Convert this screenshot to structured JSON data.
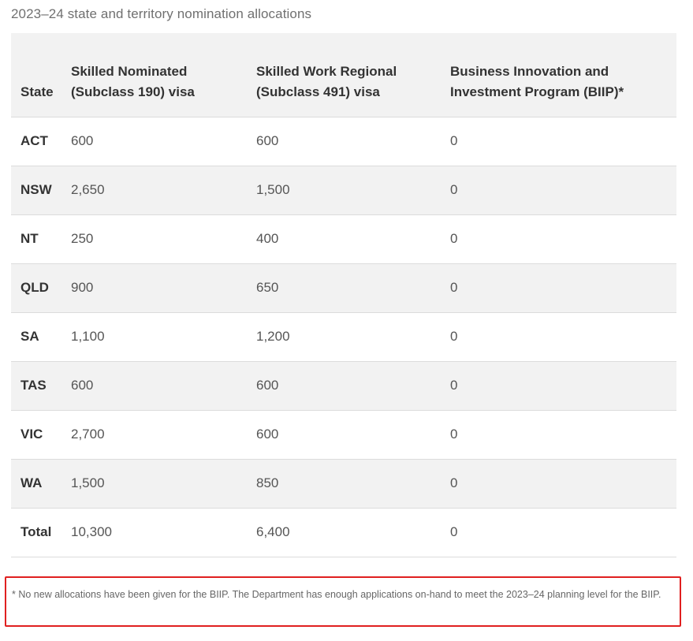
{
  "caption": "2023–24 state and territory nomination allocations",
  "table": {
    "headers": {
      "state": "State",
      "subclass190": "Skilled Nominated (Subclass 190) visa",
      "subclass491": "Skilled Work Regional (Subclass 491) visa",
      "biip": "Business Innovation and Investment Program (BIIP)*"
    },
    "rows": [
      {
        "state": "ACT",
        "subclass190": "600",
        "subclass491": "600",
        "biip": "0"
      },
      {
        "state": "NSW",
        "subclass190": "2,650",
        "subclass491": "1,500",
        "biip": "0"
      },
      {
        "state": "NT",
        "subclass190": "250",
        "subclass491": "400",
        "biip": "0"
      },
      {
        "state": "QLD",
        "subclass190": "900",
        "subclass491": "650",
        "biip": "0"
      },
      {
        "state": "SA",
        "subclass190": "1,100",
        "subclass491": "1,200",
        "biip": "0"
      },
      {
        "state": "TAS",
        "subclass190": "600",
        "subclass491": "600",
        "biip": "0"
      },
      {
        "state": "VIC",
        "subclass190": "2,700",
        "subclass491": "600",
        "biip": "0"
      },
      {
        "state": "WA",
        "subclass190": "1,500",
        "subclass491": "850",
        "biip": "0"
      },
      {
        "state": "Total",
        "subclass190": "10,300",
        "subclass491": "6,400",
        "biip": "0"
      }
    ]
  },
  "footnote": "* No new allocations have been given for the BIIP. The Department has enough applications on-hand to meet the 2023–24 planning level for the BIIP.",
  "colors": {
    "header_bg": "#f2f2f2",
    "stripe_bg": "#f2f2f2",
    "highlight_border": "#e02020"
  }
}
